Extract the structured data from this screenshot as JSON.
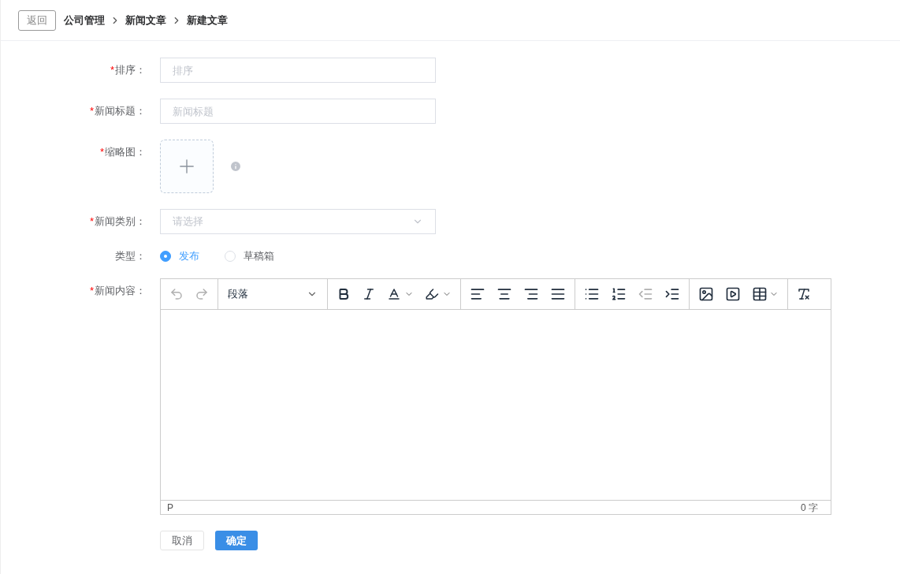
{
  "header": {
    "back_button": "返回",
    "breadcrumb": [
      "公司管理",
      "新闻文章",
      "新建文章"
    ]
  },
  "fields": [
    {
      "kind": "input",
      "label": "排序：",
      "required_mark": "*",
      "placeholder": "排序"
    },
    {
      "kind": "input",
      "label": "新闻标题：",
      "required_mark": "*",
      "placeholder": "新闻标题"
    },
    {
      "kind": "upload",
      "label": "缩略图：",
      "required_mark": "*"
    },
    {
      "kind": "select",
      "label": "新闻类别：",
      "required_mark": "*",
      "placeholder": "请选择"
    },
    {
      "kind": "radio",
      "label": "类型：",
      "options": [
        {
          "label": "发布",
          "selected": true
        },
        {
          "label": "草稿箱",
          "selected": false
        }
      ]
    },
    {
      "kind": "editor",
      "label": "新闻内容：",
      "required_mark": "*",
      "block_format": "段落",
      "path": "P",
      "word_count": "0 字"
    }
  ],
  "buttons": [
    {
      "label": "取消",
      "kind": "default"
    },
    {
      "label": "确定",
      "kind": "primary"
    }
  ]
}
